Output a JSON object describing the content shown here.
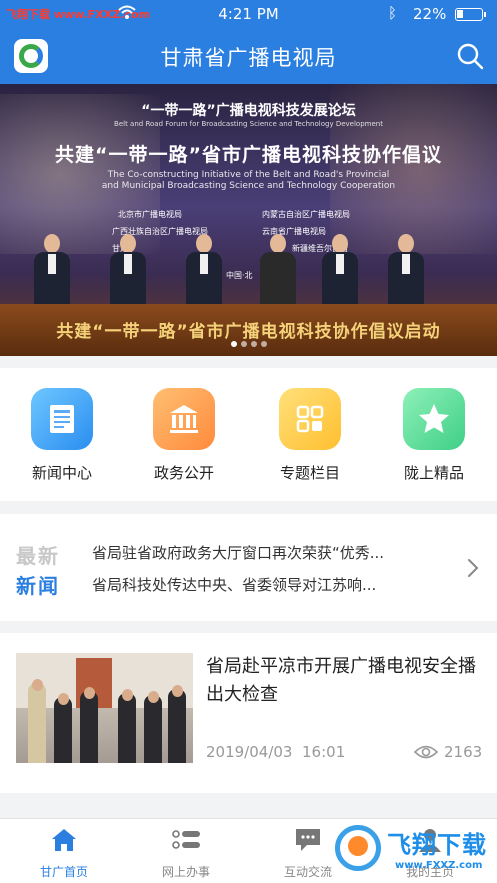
{
  "status_bar": {
    "carrier": "飞翔下载 www.FXXZ.com",
    "time": "4:21 PM",
    "battery_percent": "22%",
    "battery_level": 0.22
  },
  "header": {
    "title": "甘肃省广播电视局",
    "logo_icon": "app-logo",
    "search_icon": "search-icon",
    "brand_color": "#2b7fe0"
  },
  "banner": {
    "forum_title": "“一带一路”广播电视科技发展论坛",
    "forum_title_en": "Belt and Road Forum for Broadcasting Science and Technology Development",
    "headline": "共建“一带一路”省市广播电视科技协作倡议",
    "headline_en_1": "The Co-constructing Initiative of the Belt and Road's Provincial",
    "headline_en_2": "and Municipal Broadcasting Science and Technology Cooperation",
    "orgs": {
      "left_1": "北京市广播电视局",
      "left_2": "广西壮族自治区广播电视局",
      "left_3": "甘肃",
      "right_1": "内蒙古自治区广播电视局",
      "right_2": "云南省广播电视局",
      "right_3": "新疆维吾尔自治"
    },
    "stage_text": "中国·北",
    "slogan": "共建“一带一路”省市广播电视科技协作倡议启动",
    "slide_count": 4,
    "active_slide": 1
  },
  "categories": [
    {
      "label": "新闻中心",
      "icon": "newspaper-icon",
      "color": "#2b8ef0"
    },
    {
      "label": "政务公开",
      "icon": "government-building-icon",
      "color": "#ff8a3c"
    },
    {
      "label": "专题栏目",
      "icon": "grid-icon",
      "color": "#ffbf2f"
    },
    {
      "label": "陇上精品",
      "icon": "star-icon",
      "color": "#3fcf86"
    }
  ],
  "latest_news": {
    "tag_top": "最新",
    "tag_bottom": "新闻",
    "items": [
      "省局驻省政府政务大厅窗口再次荣获“优秀...",
      "省局科技处传达中央、省委领导对江苏响..."
    ]
  },
  "article": {
    "headline": "省局赴平凉市开展广播电视安全播出大检查",
    "date": "2019/04/03",
    "time": "16:01",
    "views": "2163",
    "view_icon": "eye-icon"
  },
  "tabbar": {
    "tabs": [
      {
        "label": "甘广首页",
        "icon": "home-icon",
        "active": true
      },
      {
        "label": "网上办事",
        "icon": "list-icon",
        "active": false
      },
      {
        "label": "互动交流",
        "icon": "chat-icon",
        "active": false
      },
      {
        "label": "我的主页",
        "icon": "user-icon",
        "active": false
      }
    ]
  },
  "watermark": {
    "brand": "飞翔下载",
    "site": "www.FXXZ.com"
  }
}
